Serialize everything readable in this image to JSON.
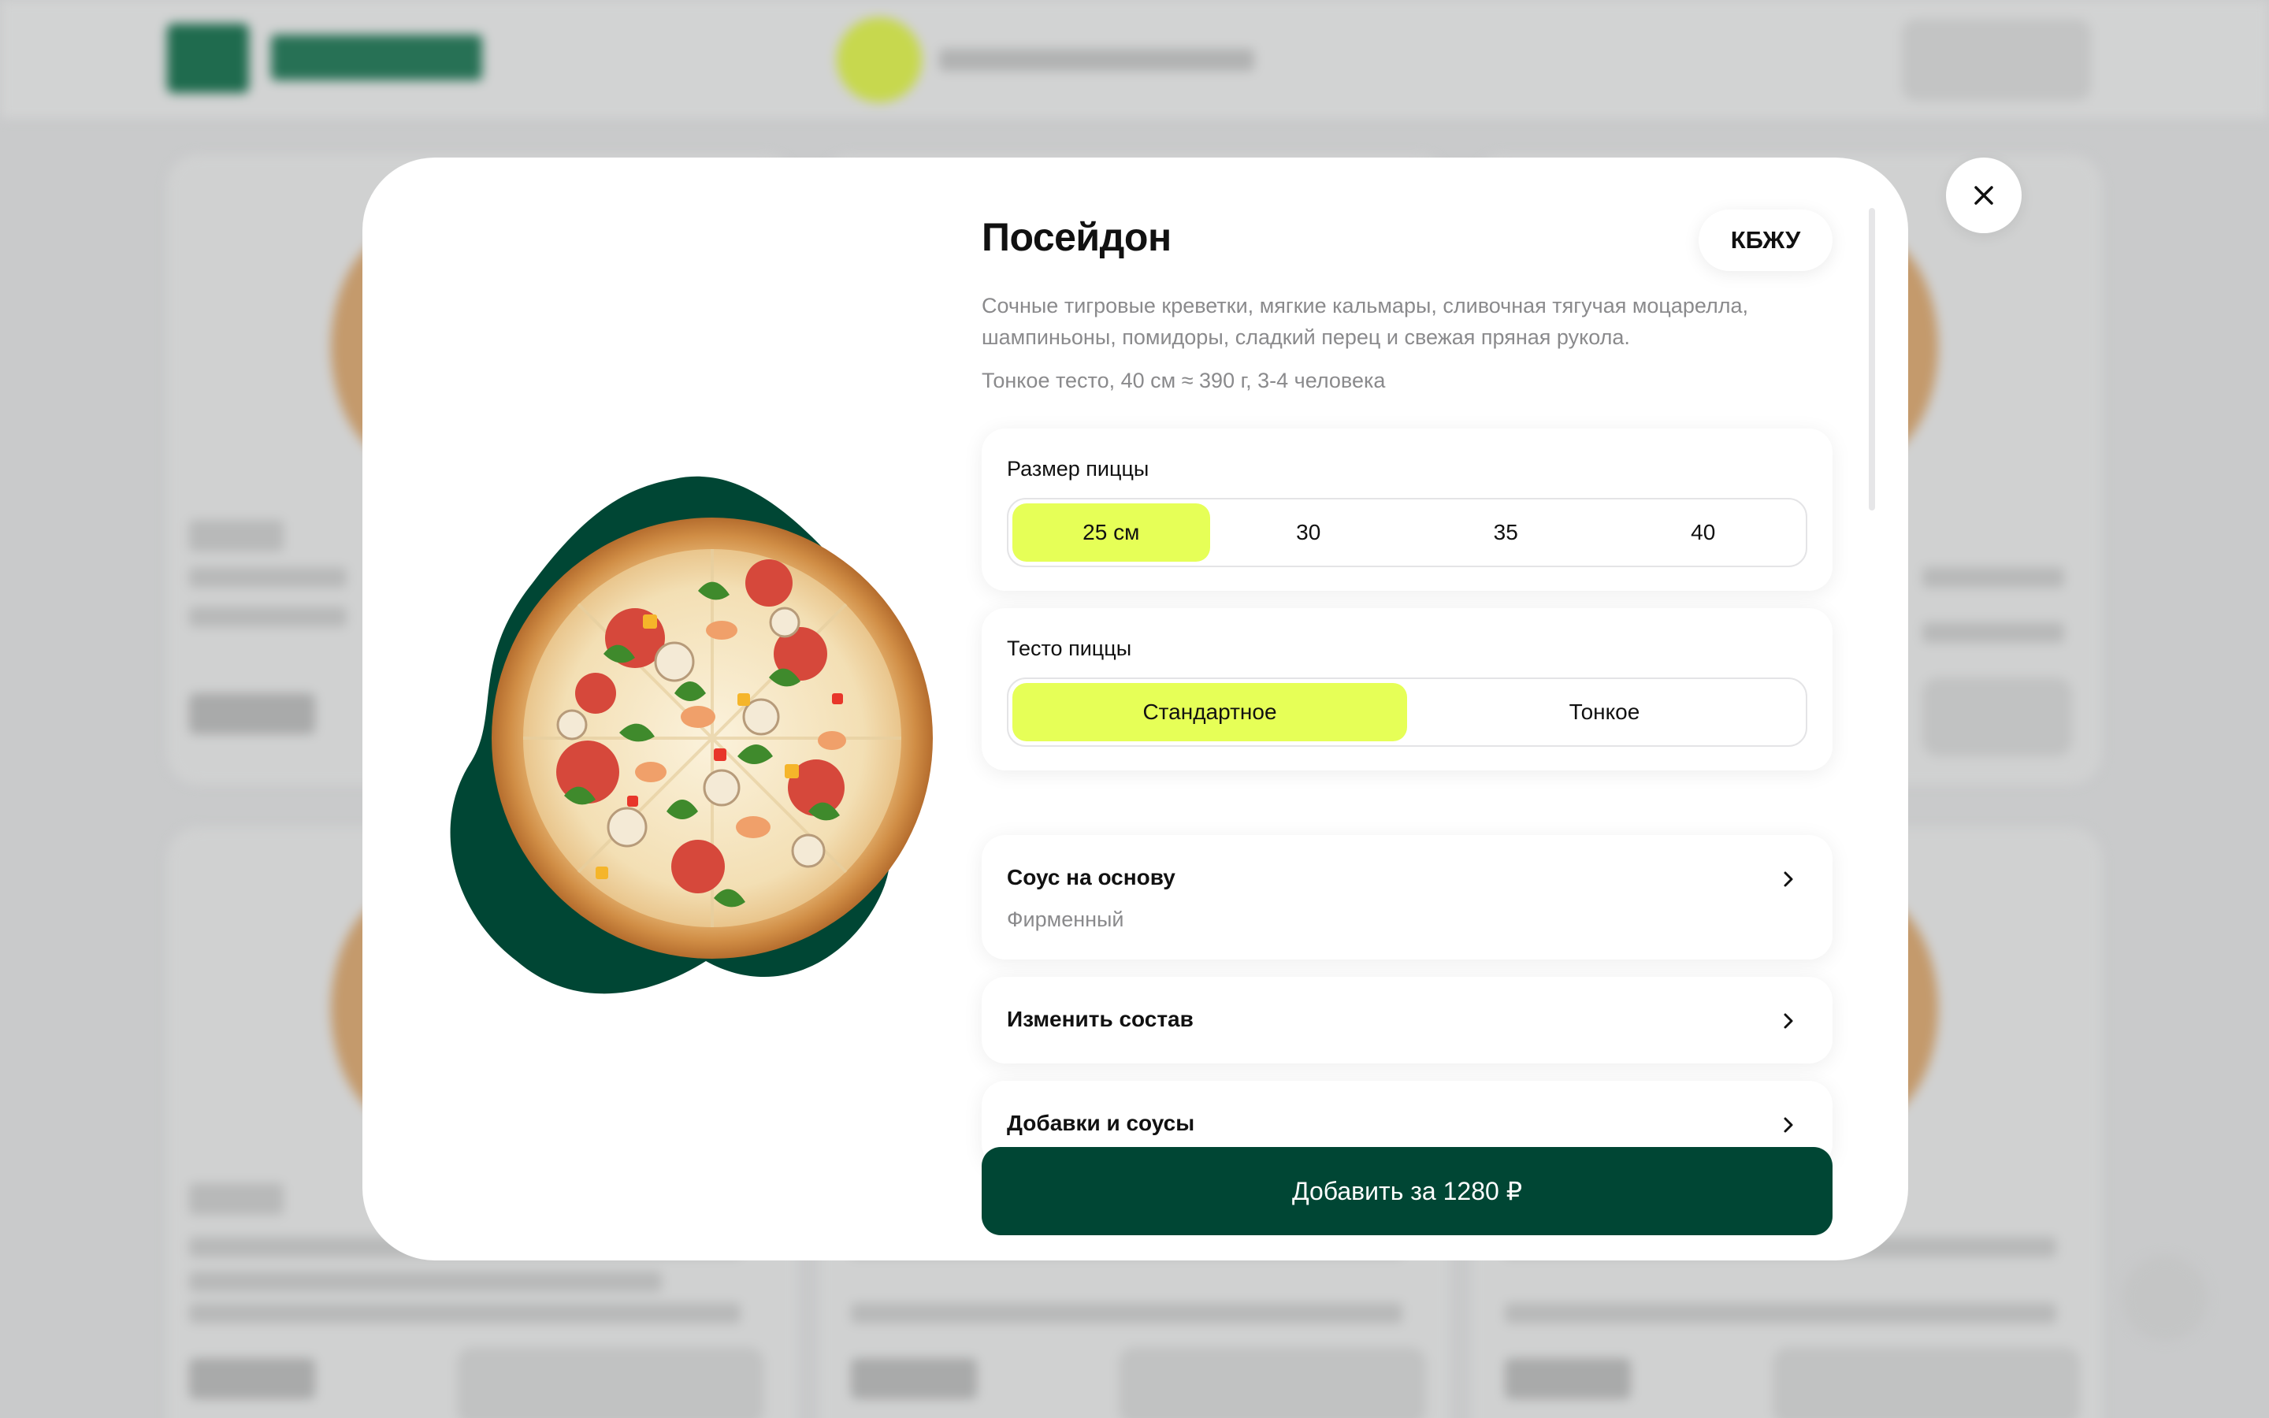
{
  "product": {
    "name": "Посейдон",
    "description": "Сочные тигровые креветки, мягкие кальмары, сливочная тягучая моцарелла, шампиньоны, помидоры, сладкий перец и свежая пряная рукола.",
    "meta": "Тонкое тесто, 40 см ≈ 390 г, 3-4 человека",
    "kbju_label": "КБЖУ"
  },
  "size": {
    "label": "Размер пиццы",
    "options": [
      "25 см",
      "30",
      "35",
      "40"
    ],
    "selected": "25 см"
  },
  "dough": {
    "label": "Тесто пиццы",
    "options": [
      "Стандартное",
      "Тонкое"
    ],
    "selected": "Стандартное"
  },
  "rows": [
    {
      "label": "Соус на основу",
      "value": "Фирменный"
    },
    {
      "label": "Изменить состав"
    },
    {
      "label": "Добавки и соусы"
    }
  ],
  "add_button": {
    "label": "Добавить за 1280 ₽"
  },
  "icons": {
    "close": "close-icon",
    "chevron": "chevron-right-icon",
    "pizza_image": "pizza-image"
  },
  "colors": {
    "accent": "#e6ff57",
    "brand_dark": "#004634",
    "muted_text": "#8a8a8c"
  }
}
